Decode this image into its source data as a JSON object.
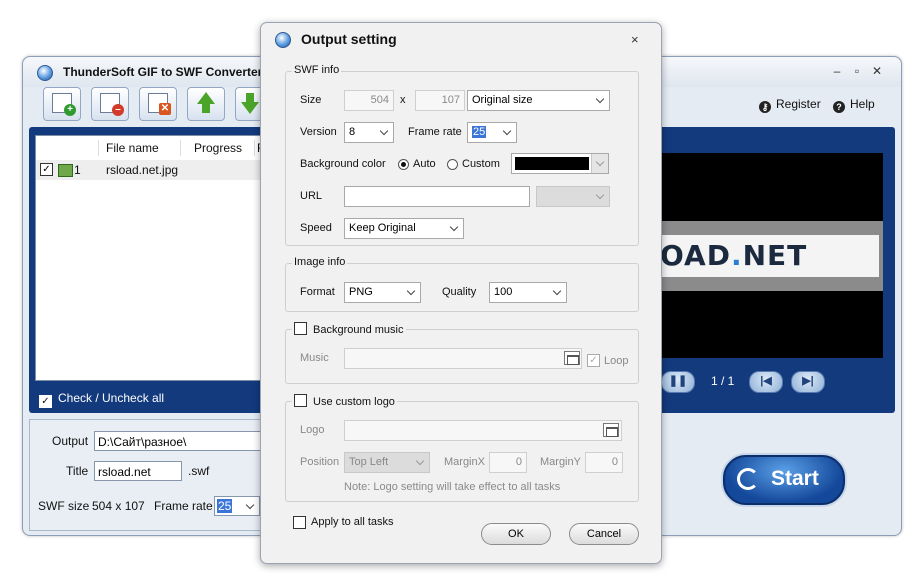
{
  "main": {
    "title": "ThunderSoft GIF to SWF Converter (",
    "controls": {
      "minimize": "–",
      "maximize": "▫",
      "close": "✕"
    },
    "toolbar": {
      "buttons": [
        {
          "icon": "add-image-icon"
        },
        {
          "icon": "remove-image-icon"
        },
        {
          "icon": "clear-list-icon"
        },
        {
          "icon": "move-up-icon"
        },
        {
          "icon": "move-down-icon"
        }
      ]
    },
    "register_label": "Register",
    "help_label": "Help",
    "list": {
      "columns": [
        "File name",
        "Progress",
        "F"
      ],
      "rows": [
        {
          "index": "1",
          "file": "rsload.net.jpg",
          "checked": true
        }
      ]
    },
    "check_all_label": "Check / Uncheck all",
    "output_label": "Output",
    "output_value": "D:\\Сайт\\разное\\",
    "title_label": "Title",
    "title_value": "rsload.net",
    "title_ext": ".swf",
    "swf_size_label": "SWF size",
    "swf_size_value": "504 x 107",
    "frame_rate_label": "Frame rate",
    "frame_rate_value": "25",
    "preview": {
      "text_dark": "OAD",
      "text_dot": ".",
      "text_tail": "NET",
      "page_counter": "1 / 1",
      "pause_glyph": "❚❚",
      "first_glyph": "|◀",
      "next_glyph": "▶|"
    },
    "start_label": "Start"
  },
  "dialog": {
    "title": "Output setting",
    "close_glyph": "×",
    "swf_info": {
      "legend": "SWF info",
      "size_label": "Size",
      "width": "504",
      "x_label": "x",
      "height": "107",
      "size_preset": "Original size",
      "version_label": "Version",
      "version": "8",
      "frame_rate_label": "Frame rate",
      "frame_rate": "25",
      "bg_color_label": "Background color",
      "auto_label": "Auto",
      "custom_label": "Custom",
      "bg_mode": "auto",
      "bg_color": "#000000",
      "url_label": "URL",
      "url_value": "",
      "url_target": "",
      "speed_label": "Speed",
      "speed_value": "Keep Original"
    },
    "image_info": {
      "legend": "Image info",
      "format_label": "Format",
      "format": "PNG",
      "quality_label": "Quality",
      "quality": "100"
    },
    "background_music": {
      "legend": "Background music",
      "enabled": false,
      "music_label": "Music",
      "music_value": "",
      "loop_label": "Loop",
      "loop_checked": true
    },
    "custom_logo": {
      "legend": "Use custom logo",
      "enabled": false,
      "logo_label": "Logo",
      "logo_value": "",
      "position_label": "Position",
      "position_value": "Top Left",
      "margin_x_label": "MarginX",
      "margin_x": "0",
      "margin_y_label": "MarginY",
      "margin_y": "0",
      "note": "Note: Logo setting will take effect to all tasks"
    },
    "apply_all_label": "Apply to all tasks",
    "apply_all_checked": false,
    "ok_label": "OK",
    "cancel_label": "Cancel"
  }
}
